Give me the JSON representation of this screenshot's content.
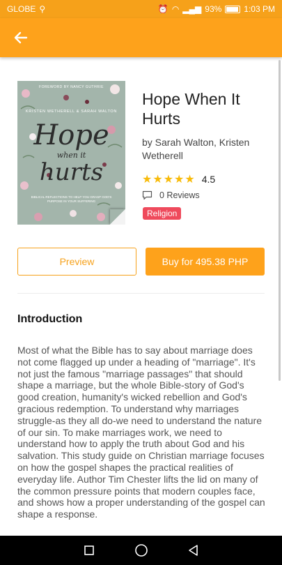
{
  "status_bar": {
    "carrier": "GLOBE",
    "battery": "93%",
    "time": "1:03 PM"
  },
  "app_bar": {
    "back_icon": "arrow-left-icon"
  },
  "book": {
    "title": "Hope When It Hurts",
    "authors": "by Sarah Walton, Kristen Wetherell",
    "rating_value": "4.5",
    "stars_filled": 5,
    "reviews": "0 Reviews",
    "genre": "Religion",
    "cover": {
      "foreword": "FOREWORD BY NANCY GUTHRIE",
      "authors": "KRISTEN WETHERELL & SARAH WALTON",
      "title_line1": "Hope",
      "title_line2": "when it",
      "title_line3": "hurts",
      "subtitle": "BIBLICAL REFLECTIONS TO HELP YOU GRASP GOD'S PURPOSE IN YOUR SUFFERING"
    }
  },
  "actions": {
    "preview_label": "Preview",
    "buy_label": "Buy for 495.38 PHP"
  },
  "introduction": {
    "heading": "Introduction",
    "text": "Most of what the Bible has to say about marriage does not come flagged up under a heading of \"marriage\". It's not just the famous \"marriage passages\" that should shape a marriage, but the whole Bible-story of God's good creation, humanity's wicked rebellion and God's gracious redemption. To understand why marriages struggle-as they all do-we need to understand the nature of our sin. To make marriages work, we need to understand how to apply the truth about God and his salvation. This study guide on Christian marriage focuses on how the gospel shapes the practical realities of everyday life. Author Tim Chester lifts the lid on many of the common pressure points that modern couples face, and shows how a proper understanding of the gospel can shape a response."
  },
  "colors": {
    "accent": "#fea21b",
    "badge": "#ef4a5c",
    "star": "#f8bb0a"
  }
}
